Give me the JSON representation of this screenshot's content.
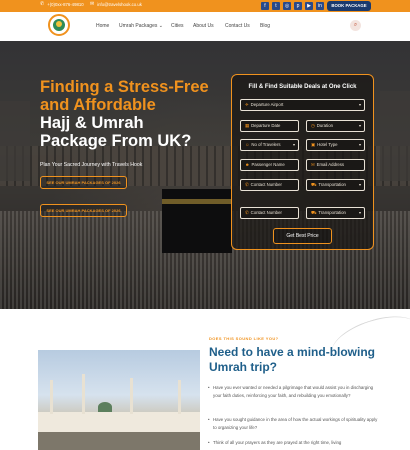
{
  "topbar": {
    "phone": "+(0)0xx-876-49810",
    "email": "info@travelshook.co.uk",
    "social_icons": [
      "facebook-icon",
      "twitter-icon",
      "instagram-icon",
      "pinterest-icon",
      "youtube-icon",
      "linkedin-icon",
      "tiktok-icon"
    ],
    "book_label": "BOOK PACKAGE"
  },
  "nav": {
    "items": [
      "Home",
      "Umrah Packages",
      "Cities",
      "About Us",
      "Contact Us",
      "Blog"
    ],
    "dropdown_marker": "⌄"
  },
  "hero": {
    "title_line1": "Finding a Stress-Free",
    "title_line2": "and Affordable",
    "title_line3": "Hajj & Umrah",
    "title_line4": "Package From UK?",
    "subtitle": "Plan Your Sacred Journey with Travels Hook",
    "btn1": "SEE OUR UMRAH PACKAGES OF 2026",
    "btn2": "SEE OUR UMRAH PACKAGES OF 2026"
  },
  "form": {
    "title": "Fill & Find Suitable Deals at One Click",
    "departure_airport": "Departure Airport",
    "departure_date": "Departure Date",
    "duration": "Duration",
    "no_travelers": "No of Travelers",
    "hotel_type": "Hotel Type",
    "passenger_name": "Passenger Name",
    "email_address": "Email Address",
    "contact_number_1": "Contact Number",
    "transportation_1": "Transportation",
    "contact_number_2": "Contact Number",
    "transportation_2": "Transportation",
    "submit": "Get Best Price"
  },
  "about": {
    "eyebrow": "DOES THIS SOUND LIKE YOU?",
    "title": "Need to have a mind-blowing Umrah trip?",
    "bullet1": "Have you ever wanted or needed a pilgrimage that would assist you in discharging your faith duties, reinforcing your faith, and rebuilding you emotionally?",
    "bullet2": "Have you sought guidance in the area of how the actual workings of spirituality apply to organizing your life?",
    "bullet3": "Think of all your prayers as they are prayed at the right time, living"
  },
  "colors": {
    "accent": "#f0921e",
    "brand_blue": "#1f5f8a",
    "dark_navy": "#1a3a6e"
  }
}
